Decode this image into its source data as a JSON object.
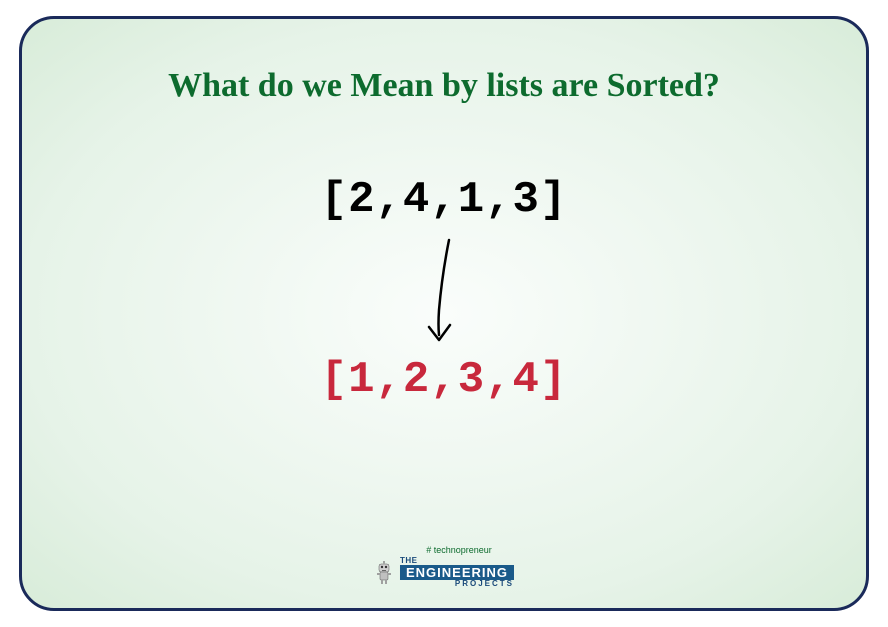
{
  "title": "What do we Mean by lists are Sorted?",
  "list_before": "[2,4,1,3]",
  "list_after": "[1,2,3,4]",
  "logo": {
    "tagline": "# technopreneur",
    "line1": "THE",
    "line2": "ENGINEERING",
    "line3": "PROJECTS"
  }
}
